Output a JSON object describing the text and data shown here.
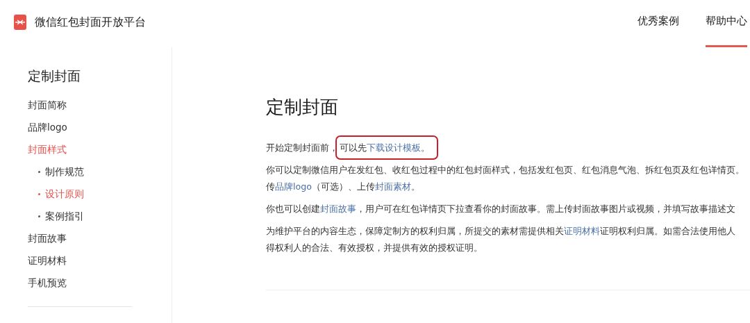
{
  "header": {
    "title": "微信红包封面开放平台",
    "nav": [
      {
        "label": "优秀案例",
        "selected": false
      },
      {
        "label": "帮助中心",
        "selected": true
      }
    ]
  },
  "sidebar": {
    "title": "定制封面",
    "items": [
      {
        "label": "封面简称",
        "selected": false
      },
      {
        "label": "品牌logo",
        "selected": false
      },
      {
        "label": "封面样式",
        "selected": true,
        "children": [
          {
            "label": "制作规范",
            "selected": false
          },
          {
            "label": "设计原则",
            "selected": true
          },
          {
            "label": "案例指引",
            "selected": false
          }
        ]
      },
      {
        "label": "封面故事",
        "selected": false
      },
      {
        "label": "证明材料",
        "selected": false
      },
      {
        "label": "手机预览",
        "selected": false
      }
    ]
  },
  "article": {
    "title": "定制封面",
    "paragraphs": [
      {
        "lines": [
          [
            {
              "kind": "text",
              "text": "开始定制封面前，"
            },
            {
              "kind": "highlight",
              "parts": [
                {
                  "kind": "text",
                  "text": "可以先"
                },
                {
                  "kind": "link",
                  "text": "下载设计模板"
                },
                {
                  "kind": "text",
                  "text": "。"
                }
              ]
            }
          ]
        ]
      },
      {
        "lines": [
          [
            {
              "kind": "text",
              "text": "你可以定制微信用户在发红包、收红包过程中的红包封面样式，包括发红包页、红包消息气泡、拆红包页及红包详情页。"
            }
          ],
          [
            {
              "kind": "text",
              "text": "传"
            },
            {
              "kind": "link",
              "text": "品牌logo"
            },
            {
              "kind": "text",
              "text": "（可选）、上传"
            },
            {
              "kind": "link",
              "text": "封面素材"
            },
            {
              "kind": "text",
              "text": "。"
            }
          ]
        ]
      },
      {
        "lines": [
          [
            {
              "kind": "text",
              "text": "你也可以创建"
            },
            {
              "kind": "link",
              "text": "封面故事"
            },
            {
              "kind": "text",
              "text": "，用户可在红包详情页下拉查看你的封面故事。需上传封面故事图片或视频，并填写故事描述文"
            }
          ]
        ]
      },
      {
        "lines": [
          [
            {
              "kind": "text",
              "text": "为维护平台的内容生态，保障定制方的权利归属，所提交的素材需提供相关"
            },
            {
              "kind": "link",
              "text": "证明材料"
            },
            {
              "kind": "text",
              "text": "证明权利归属。如需合法使用他人"
            }
          ],
          [
            {
              "kind": "text",
              "text": "得权利人的合法、有效授权，并提供有效的授权证明。"
            }
          ]
        ]
      }
    ]
  }
}
